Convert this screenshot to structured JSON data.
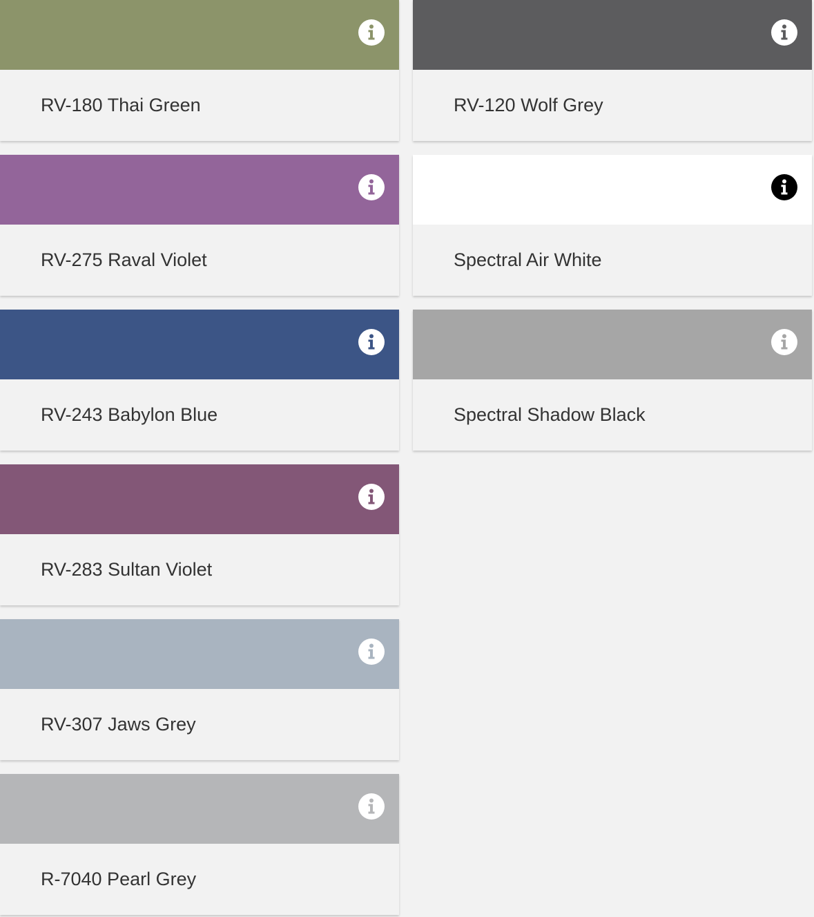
{
  "swatches_left": [
    {
      "name": "RV-180 Thai Green",
      "color": "#8c946a",
      "icon": "info-icon",
      "icon_style": "light"
    },
    {
      "name": "RV-275 Raval Violet",
      "color": "#93659a",
      "icon": "info-icon",
      "icon_style": "light"
    },
    {
      "name": "RV-243 Babylon Blue",
      "color": "#3c5586",
      "icon": "info-icon",
      "icon_style": "light"
    },
    {
      "name": "RV-283 Sultan Violet",
      "color": "#835777",
      "icon": "info-icon",
      "icon_style": "light"
    },
    {
      "name": "RV-307 Jaws Grey",
      "color": "#a9b4c0",
      "icon": "info-icon",
      "icon_style": "light"
    },
    {
      "name": "R-7040 Pearl Grey",
      "color": "#b5b6b8",
      "icon": "info-icon",
      "icon_style": "light"
    }
  ],
  "swatches_right": [
    {
      "name": "RV-120 Wolf Grey",
      "color": "#5c5c5e",
      "icon": "info-icon",
      "icon_style": "light"
    },
    {
      "name": "Spectral Air White",
      "color": "#ffffff",
      "icon": "info-icon",
      "icon_style": "dark"
    },
    {
      "name": "Spectral Shadow Black",
      "color": "#a6a6a6",
      "icon": "info-icon",
      "icon_style": "light"
    }
  ]
}
